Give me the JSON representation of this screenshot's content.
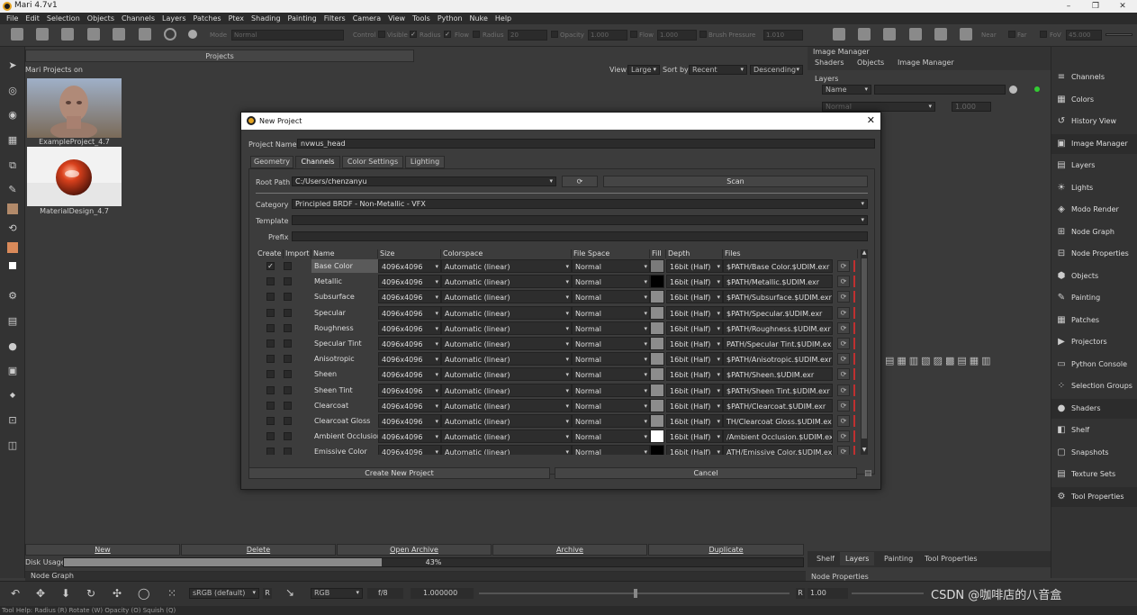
{
  "window": {
    "title": "Mari 4.7v1",
    "min": "–",
    "max": "❐",
    "close": "✕"
  },
  "menu": [
    "File",
    "Edit",
    "Selection",
    "Objects",
    "Channels",
    "Layers",
    "Patches",
    "Ptex",
    "Shading",
    "Painting",
    "Filters",
    "Camera",
    "View",
    "Tools",
    "Python",
    "Nuke",
    "Help"
  ],
  "toolbar": {
    "mode_label": "Mode",
    "mode_value": "Normal",
    "control_label": "Control",
    "visible_label": "Visible",
    "radius_label": "Radius",
    "flow_label": "Flow",
    "radius2_label": "Radius",
    "radius_value": "20",
    "opacity_label": "Opacity",
    "opacity_value": "1.000",
    "flow2_label": "Flow",
    "flow_value": "1.000",
    "brush_pressure_label": "Brush Pressure",
    "brush_pressure_value": "1.010",
    "near_label": "Near",
    "far_label": "Far",
    "fov_label": "FoV",
    "fov_value": "45.000"
  },
  "projects": {
    "panel_title": "Projects",
    "header": "Mari Projects on",
    "view_label": "View",
    "view_value": "Large",
    "sort_label": "Sort by",
    "sort_value": "Recent",
    "order_value": "Descending",
    "items": [
      {
        "name": "ExampleProject_4.7"
      },
      {
        "name": "MaterialDesign_4.7"
      }
    ],
    "buttons": {
      "new": "New",
      "delete": "Delete",
      "open_archive": "Open Archive",
      "archive": "Archive",
      "duplicate": "Duplicate"
    },
    "disk_usage_label": "Disk Usage",
    "disk_usage_value": "43%",
    "disk_usage_fraction": 0.43
  },
  "image_manager": {
    "title": "Image Manager",
    "tabs": [
      "Shaders",
      "Objects",
      "Image Manager"
    ]
  },
  "layers": {
    "title": "Layers",
    "filter_value": "Name",
    "blend_value": "Normal",
    "opacity_value": "1.000"
  },
  "right_tabs": [
    "Shelf",
    "Layers",
    "Painting",
    "Tool Properties"
  ],
  "node_props_title": "Node Properties",
  "node_graph_title": "Node Graph",
  "sidebar": [
    {
      "label": "Channels",
      "icon": "≡"
    },
    {
      "label": "Colors",
      "icon": "▦"
    },
    {
      "label": "History View",
      "icon": "↺"
    },
    {
      "label": "Image Manager",
      "icon": "▣",
      "active": true
    },
    {
      "label": "Layers",
      "icon": "▤"
    },
    {
      "label": "Lights",
      "icon": "☀"
    },
    {
      "label": "Modo Render",
      "icon": "◈"
    },
    {
      "label": "Node Graph",
      "icon": "⊞"
    },
    {
      "label": "Node Properties",
      "icon": "⊟"
    },
    {
      "label": "Objects",
      "icon": "⬢"
    },
    {
      "label": "Painting",
      "icon": "✎"
    },
    {
      "label": "Patches",
      "icon": "▦"
    },
    {
      "label": "Projectors",
      "icon": "▶"
    },
    {
      "label": "Python Console",
      "icon": "▭"
    },
    {
      "label": "Selection Groups",
      "icon": "⁘"
    },
    {
      "label": "Shaders",
      "icon": "●",
      "active": true
    },
    {
      "label": "Shelf",
      "icon": "◧"
    },
    {
      "label": "Snapshots",
      "icon": "▢"
    },
    {
      "label": "Texture Sets",
      "icon": "▤"
    },
    {
      "label": "Tool Properties",
      "icon": "⚙",
      "active": true
    }
  ],
  "bottombar": {
    "colorspace": "sRGB (default)",
    "r_label": "R",
    "channel": "RGB",
    "fstop": "f/8",
    "exposure": "1.000000",
    "r2_label": "R",
    "gain": "1.00"
  },
  "statusbar": {
    "text": "Tool Help:   Radius (R)   Rotate (W)   Opacity (O)   Squish (Q)"
  },
  "watermark": "CSDN @咖啡店的八音盒",
  "dialog": {
    "title": "New Project",
    "close": "✕",
    "project_name_label": "Project Name",
    "project_name_value": "nvwus_head",
    "tabs": [
      "Geometry",
      "Channels",
      "Color Settings",
      "Lighting"
    ],
    "active_tab": 1,
    "root_path_label": "Root Path",
    "root_path_value": "C:/Users/chenzanyu",
    "scan_label": "Scan",
    "category_label": "Category",
    "category_value": "Principled BRDF - Non-Metallic - VFX",
    "template_label": "Template",
    "template_value": "",
    "prefix_label": "Prefix",
    "prefix_value": "",
    "table": {
      "headers": [
        "Create",
        "Import",
        "Name",
        "Size",
        "Colorspace",
        "File Space",
        "Fill",
        "Depth",
        "Files"
      ],
      "rows": [
        {
          "create": true,
          "name": "Base Color",
          "size": "4096x4096",
          "colorspace": "Automatic (linear)",
          "filespace": "Normal",
          "fill": "#7a7a7a",
          "depth": "16bit (Half)",
          "files": "$PATH/Base Color.$UDIM.exr"
        },
        {
          "create": false,
          "name": "Metallic",
          "size": "4096x4096",
          "colorspace": "Automatic (linear)",
          "filespace": "Normal",
          "fill": "#000000",
          "depth": "16bit (Half)",
          "files": "$PATH/Metallic.$UDIM.exr"
        },
        {
          "create": false,
          "name": "Subsurface",
          "size": "4096x4096",
          "colorspace": "Automatic (linear)",
          "filespace": "Normal",
          "fill": "#8c8c8c",
          "depth": "16bit (Half)",
          "files": "$PATH/Subsurface.$UDIM.exr"
        },
        {
          "create": false,
          "name": "Specular",
          "size": "4096x4096",
          "colorspace": "Automatic (linear)",
          "filespace": "Normal",
          "fill": "#8c8c8c",
          "depth": "16bit (Half)",
          "files": "$PATH/Specular.$UDIM.exr"
        },
        {
          "create": false,
          "name": "Roughness",
          "size": "4096x4096",
          "colorspace": "Automatic (linear)",
          "filespace": "Normal",
          "fill": "#8c8c8c",
          "depth": "16bit (Half)",
          "files": "$PATH/Roughness.$UDIM.exr"
        },
        {
          "create": false,
          "name": "Specular Tint",
          "size": "4096x4096",
          "colorspace": "Automatic (linear)",
          "filespace": "Normal",
          "fill": "#8c8c8c",
          "depth": "16bit (Half)",
          "files": "PATH/Specular Tint.$UDIM.exr"
        },
        {
          "create": false,
          "name": "Anisotropic",
          "size": "4096x4096",
          "colorspace": "Automatic (linear)",
          "filespace": "Normal",
          "fill": "#8c8c8c",
          "depth": "16bit (Half)",
          "files": "$PATH/Anisotropic.$UDIM.exr"
        },
        {
          "create": false,
          "name": "Sheen",
          "size": "4096x4096",
          "colorspace": "Automatic (linear)",
          "filespace": "Normal",
          "fill": "#8c8c8c",
          "depth": "16bit (Half)",
          "files": "$PATH/Sheen.$UDIM.exr"
        },
        {
          "create": false,
          "name": "Sheen Tint",
          "size": "4096x4096",
          "colorspace": "Automatic (linear)",
          "filespace": "Normal",
          "fill": "#8c8c8c",
          "depth": "16bit (Half)",
          "files": "$PATH/Sheen Tint.$UDIM.exr"
        },
        {
          "create": false,
          "name": "Clearcoat",
          "size": "4096x4096",
          "colorspace": "Automatic (linear)",
          "filespace": "Normal",
          "fill": "#8c8c8c",
          "depth": "16bit (Half)",
          "files": "$PATH/Clearcoat.$UDIM.exr"
        },
        {
          "create": false,
          "name": "Clearcoat Gloss",
          "size": "4096x4096",
          "colorspace": "Automatic (linear)",
          "filespace": "Normal",
          "fill": "#8c8c8c",
          "depth": "16bit (Half)",
          "files": "TH/Clearcoat Gloss.$UDIM.exr"
        },
        {
          "create": false,
          "name": "Ambient Occlusion",
          "size": "4096x4096",
          "colorspace": "Automatic (linear)",
          "filespace": "Normal",
          "fill": "#ffffff",
          "depth": "16bit (Half)",
          "files": "/Ambient Occlusion.$UDIM.exr"
        },
        {
          "create": false,
          "name": "Emissive Color",
          "size": "4096x4096",
          "colorspace": "Automatic (linear)",
          "filespace": "Normal",
          "fill": "#000000",
          "depth": "16bit (Half)",
          "files": "ATH/Emissive Color.$UDIM.exr"
        }
      ]
    },
    "create_button": "Create New Project",
    "cancel_button": "Cancel"
  },
  "colors": {
    "accent": "#e4a320",
    "disk_bar": "#8a8a8a",
    "row_mark": "#c03030"
  }
}
